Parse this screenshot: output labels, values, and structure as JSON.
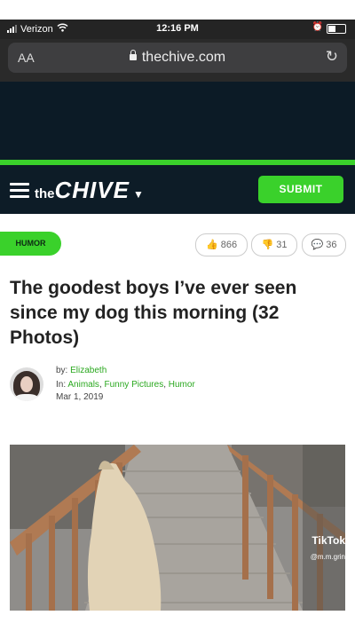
{
  "status_bar": {
    "carrier": "Verizon",
    "time": "12:16 PM"
  },
  "browser": {
    "aa_label": "AA",
    "url": "thechive.com"
  },
  "nav": {
    "logo_the": "the",
    "logo_chive": "CHIVE",
    "submit_label": "SUBMIT"
  },
  "article": {
    "category": "HUMOR",
    "likes": "866",
    "dislikes": "31",
    "comments": "36",
    "title": "The goodest boys I’ve ever seen since my dog this morning (32 Photos)",
    "by_prefix": "by:",
    "author": "Elizabeth",
    "in_prefix": "In:",
    "categories": [
      "Animals",
      "Funny Pictures",
      "Humor"
    ],
    "date": "Mar 1, 2019"
  },
  "media": {
    "watermark": "TikTok",
    "username": "@m.m.grin"
  },
  "colors": {
    "brand_green": "#3ad12b",
    "navy": "#0d1c27"
  }
}
